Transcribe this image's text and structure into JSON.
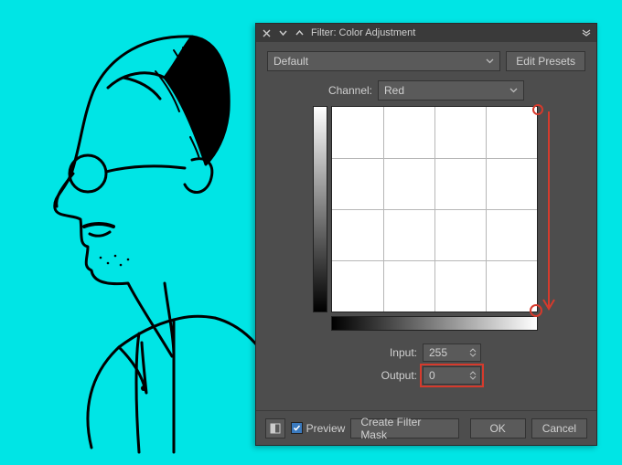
{
  "titlebar": {
    "title": "Filter: Color Adjustment"
  },
  "preset": {
    "selected": "Default",
    "edit_label": "Edit Presets"
  },
  "channel": {
    "label": "Channel:",
    "selected": "Red"
  },
  "input": {
    "label": "Input:",
    "value": "255"
  },
  "output": {
    "label": "Output:",
    "value": "0"
  },
  "footer": {
    "preview_label": "Preview",
    "preview_checked": true,
    "mask_label": "Create Filter Mask",
    "ok_label": "OK",
    "cancel_label": "Cancel"
  },
  "annotations": {
    "arrow_color": "#d63a2c"
  }
}
